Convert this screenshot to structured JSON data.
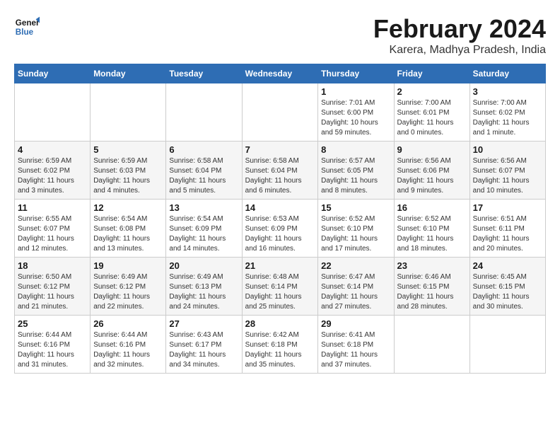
{
  "logo": {
    "line1": "General",
    "line2": "Blue"
  },
  "title": "February 2024",
  "subtitle": "Karera, Madhya Pradesh, India",
  "days_of_week": [
    "Sunday",
    "Monday",
    "Tuesday",
    "Wednesday",
    "Thursday",
    "Friday",
    "Saturday"
  ],
  "weeks": [
    [
      {
        "day": "",
        "info": ""
      },
      {
        "day": "",
        "info": ""
      },
      {
        "day": "",
        "info": ""
      },
      {
        "day": "",
        "info": ""
      },
      {
        "day": "1",
        "info": "Sunrise: 7:01 AM\nSunset: 6:00 PM\nDaylight: 10 hours and 59 minutes."
      },
      {
        "day": "2",
        "info": "Sunrise: 7:00 AM\nSunset: 6:01 PM\nDaylight: 11 hours and 0 minutes."
      },
      {
        "day": "3",
        "info": "Sunrise: 7:00 AM\nSunset: 6:02 PM\nDaylight: 11 hours and 1 minute."
      }
    ],
    [
      {
        "day": "4",
        "info": "Sunrise: 6:59 AM\nSunset: 6:02 PM\nDaylight: 11 hours and 3 minutes."
      },
      {
        "day": "5",
        "info": "Sunrise: 6:59 AM\nSunset: 6:03 PM\nDaylight: 11 hours and 4 minutes."
      },
      {
        "day": "6",
        "info": "Sunrise: 6:58 AM\nSunset: 6:04 PM\nDaylight: 11 hours and 5 minutes."
      },
      {
        "day": "7",
        "info": "Sunrise: 6:58 AM\nSunset: 6:04 PM\nDaylight: 11 hours and 6 minutes."
      },
      {
        "day": "8",
        "info": "Sunrise: 6:57 AM\nSunset: 6:05 PM\nDaylight: 11 hours and 8 minutes."
      },
      {
        "day": "9",
        "info": "Sunrise: 6:56 AM\nSunset: 6:06 PM\nDaylight: 11 hours and 9 minutes."
      },
      {
        "day": "10",
        "info": "Sunrise: 6:56 AM\nSunset: 6:07 PM\nDaylight: 11 hours and 10 minutes."
      }
    ],
    [
      {
        "day": "11",
        "info": "Sunrise: 6:55 AM\nSunset: 6:07 PM\nDaylight: 11 hours and 12 minutes."
      },
      {
        "day": "12",
        "info": "Sunrise: 6:54 AM\nSunset: 6:08 PM\nDaylight: 11 hours and 13 minutes."
      },
      {
        "day": "13",
        "info": "Sunrise: 6:54 AM\nSunset: 6:09 PM\nDaylight: 11 hours and 14 minutes."
      },
      {
        "day": "14",
        "info": "Sunrise: 6:53 AM\nSunset: 6:09 PM\nDaylight: 11 hours and 16 minutes."
      },
      {
        "day": "15",
        "info": "Sunrise: 6:52 AM\nSunset: 6:10 PM\nDaylight: 11 hours and 17 minutes."
      },
      {
        "day": "16",
        "info": "Sunrise: 6:52 AM\nSunset: 6:10 PM\nDaylight: 11 hours and 18 minutes."
      },
      {
        "day": "17",
        "info": "Sunrise: 6:51 AM\nSunset: 6:11 PM\nDaylight: 11 hours and 20 minutes."
      }
    ],
    [
      {
        "day": "18",
        "info": "Sunrise: 6:50 AM\nSunset: 6:12 PM\nDaylight: 11 hours and 21 minutes."
      },
      {
        "day": "19",
        "info": "Sunrise: 6:49 AM\nSunset: 6:12 PM\nDaylight: 11 hours and 22 minutes."
      },
      {
        "day": "20",
        "info": "Sunrise: 6:49 AM\nSunset: 6:13 PM\nDaylight: 11 hours and 24 minutes."
      },
      {
        "day": "21",
        "info": "Sunrise: 6:48 AM\nSunset: 6:14 PM\nDaylight: 11 hours and 25 minutes."
      },
      {
        "day": "22",
        "info": "Sunrise: 6:47 AM\nSunset: 6:14 PM\nDaylight: 11 hours and 27 minutes."
      },
      {
        "day": "23",
        "info": "Sunrise: 6:46 AM\nSunset: 6:15 PM\nDaylight: 11 hours and 28 minutes."
      },
      {
        "day": "24",
        "info": "Sunrise: 6:45 AM\nSunset: 6:15 PM\nDaylight: 11 hours and 30 minutes."
      }
    ],
    [
      {
        "day": "25",
        "info": "Sunrise: 6:44 AM\nSunset: 6:16 PM\nDaylight: 11 hours and 31 minutes."
      },
      {
        "day": "26",
        "info": "Sunrise: 6:44 AM\nSunset: 6:16 PM\nDaylight: 11 hours and 32 minutes."
      },
      {
        "day": "27",
        "info": "Sunrise: 6:43 AM\nSunset: 6:17 PM\nDaylight: 11 hours and 34 minutes."
      },
      {
        "day": "28",
        "info": "Sunrise: 6:42 AM\nSunset: 6:18 PM\nDaylight: 11 hours and 35 minutes."
      },
      {
        "day": "29",
        "info": "Sunrise: 6:41 AM\nSunset: 6:18 PM\nDaylight: 11 hours and 37 minutes."
      },
      {
        "day": "",
        "info": ""
      },
      {
        "day": "",
        "info": ""
      }
    ]
  ]
}
